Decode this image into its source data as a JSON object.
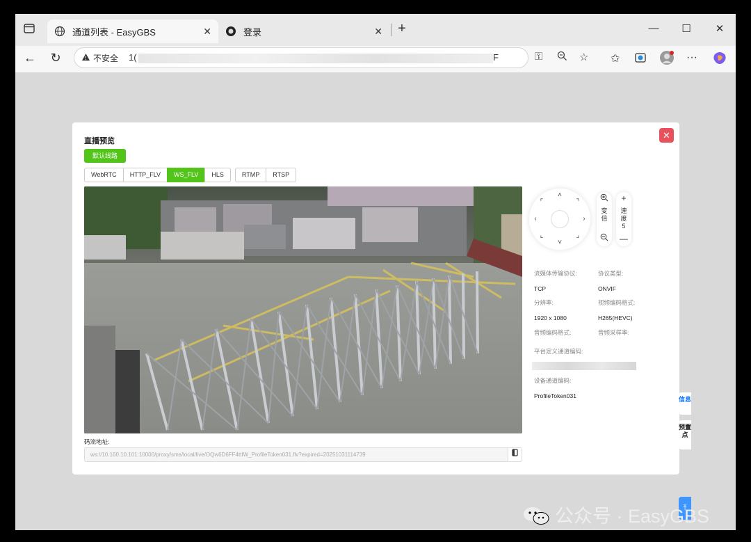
{
  "browser": {
    "tabs": [
      {
        "title": "通道列表 - EasyGBS",
        "close": "✕"
      },
      {
        "title": "登录",
        "close": "✕"
      }
    ],
    "new_tab": "+",
    "window_controls": {
      "minimize": "—",
      "maximize": "☐",
      "close": "✕"
    },
    "nav": {
      "back": "←",
      "reload": "↻"
    },
    "address": {
      "security_label": "不安全",
      "url_start": "1(",
      "url_end": "F"
    }
  },
  "modal": {
    "title": "直播预览",
    "close": "✕",
    "route_button": "默认线路",
    "protocols": [
      "WebRTC",
      "HTTP_FLV",
      "WS_FLV",
      "HLS",
      "RTMP",
      "RTSP"
    ],
    "selected_protocol": "WS_FLV",
    "ptz": {
      "zoom_label": "变倍",
      "speed_label": "速度",
      "speed_value": "5"
    },
    "info": {
      "transport_label": "流媒体传输协议:",
      "transport_value": "TCP",
      "protocol_type_label": "协议类型:",
      "protocol_type_value": "ONVIF",
      "resolution_label": "分辨率:",
      "resolution_value": "1920 x 1080",
      "video_codec_label": "视频编码格式:",
      "video_codec_value": "H265(HEVC)",
      "audio_codec_label": "音频编码格式:",
      "audio_rate_label": "音频采样率:",
      "platform_channel_label": "平台定义通道编码:",
      "device_channel_label": "设备通道编码:",
      "device_channel_value": "ProfileToken031"
    },
    "stream_label": "码流地址:",
    "stream_url": "ws://10.160.10.101:10000/proxy/sms/local/live/OQw6D6FF4ttIW_ProfileToken031.flv?expired=20251031114739"
  },
  "side_tabs": [
    "信息",
    "预置点"
  ],
  "side_bottom": "⤒",
  "watermark": "公众号 · EasyGBS",
  "colors": {
    "accent_green": "#52c41a",
    "close_red": "#e8505b",
    "side_blue": "#4096ff"
  }
}
